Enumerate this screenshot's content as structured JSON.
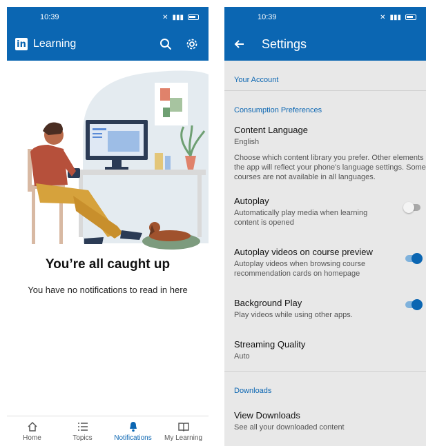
{
  "left": {
    "status_time": "10:39",
    "app_name": "Learning",
    "logo_text": "in",
    "empty_title": "You’re all caught up",
    "empty_subtitle": "You have no notifications to read in here",
    "nav": [
      {
        "label": "Home",
        "icon": "home-icon"
      },
      {
        "label": "Topics",
        "icon": "list-icon"
      },
      {
        "label": "Notifications",
        "icon": "bell-icon",
        "active": true
      },
      {
        "label": "My Learning",
        "icon": "book-icon"
      }
    ]
  },
  "right": {
    "status_time": "10:39",
    "title": "Settings",
    "sections": {
      "your_account": "Your Account",
      "consumption": "Consumption Preferences",
      "downloads": "Downloads"
    },
    "content_language": {
      "title": "Content Language",
      "value": "English",
      "description": "Choose which content library you prefer. Other elements of the app will reflect your phone's language settings. Some courses are not available in all languages."
    },
    "autoplay": {
      "title": "Autoplay",
      "subtitle": "Automatically play media when learning content is opened",
      "enabled": false
    },
    "autoplay_preview": {
      "title": "Autoplay videos on course preview",
      "subtitle": "Autoplay videos when browsing course recommendation cards on homepage",
      "enabled": true
    },
    "background_play": {
      "title": "Background Play",
      "subtitle": "Play videos while using other apps.",
      "enabled": true
    },
    "streaming_quality": {
      "title": "Streaming Quality",
      "value": "Auto"
    },
    "view_downloads": {
      "title": "View Downloads",
      "subtitle": "See all your downloaded content"
    }
  },
  "colors": {
    "brand": "#0b66b2",
    "settings_bg": "#e8e8e8",
    "toggle_on": "#0b66b2",
    "toggle_off": "#a9a9a9"
  }
}
